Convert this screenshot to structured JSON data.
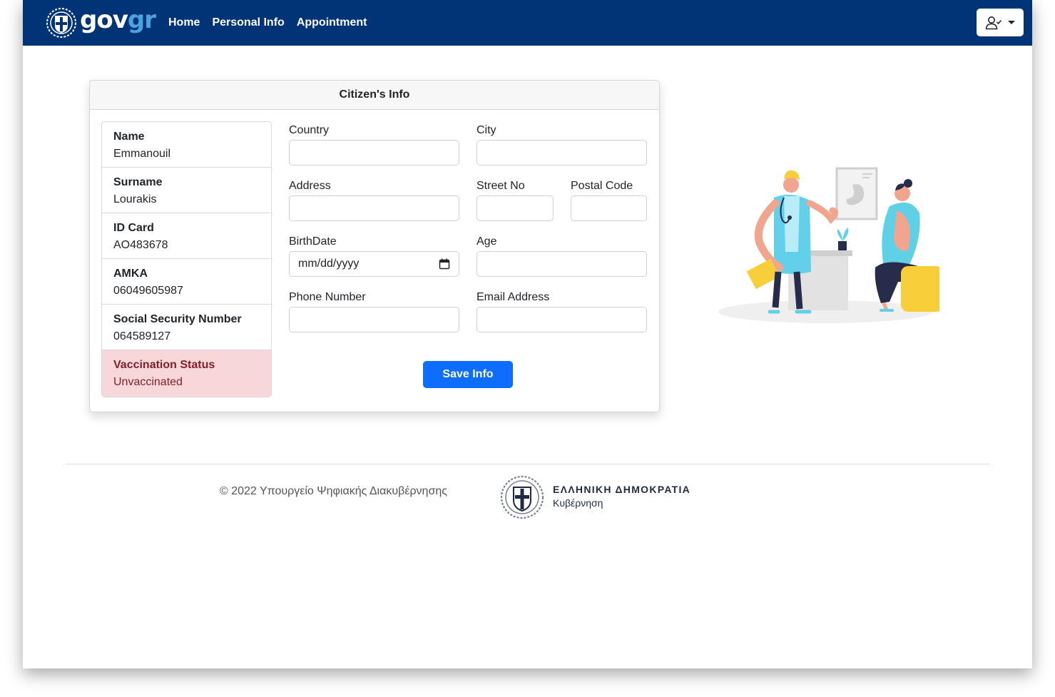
{
  "navbar": {
    "brand_gov": "gov",
    "brand_gr": "gr",
    "links": [
      "Home",
      "Personal Info",
      "Appointment"
    ]
  },
  "card": {
    "title": "Citizen's Info",
    "info": [
      {
        "label": "Name",
        "value": "Emmanouil"
      },
      {
        "label": "Surname",
        "value": "Lourakis"
      },
      {
        "label": "ID Card",
        "value": "AO483678"
      },
      {
        "label": "AMKA",
        "value": "06049605987"
      },
      {
        "label": "Social Security Number",
        "value": "064589127"
      },
      {
        "label": "Vaccination Status",
        "value": "Unvaccinated"
      }
    ],
    "fields": {
      "country": "Country",
      "city": "City",
      "address": "Address",
      "street_no": "Street No",
      "postal_code": "Postal Code",
      "birthdate": "BirthDate",
      "birthdate_placeholder": "mm/dd/yyyy",
      "age": "Age",
      "phone": "Phone Number",
      "email": "Email Address"
    },
    "save_label": "Save Info"
  },
  "footer": {
    "copyright": "© 2022 Υπουργείο Ψηφιακής Διακυβέρνησης",
    "gov_name": "ΕΛΛΗΝΙΚΗ ΔΗΜΟΚΡΑΤΙΑ",
    "gov_sub": "Κυβέρνηση"
  },
  "colors": {
    "navbar": "#003476",
    "primary": "#0d6efd",
    "danger_bg": "#f8d7da",
    "danger_text": "#842029"
  },
  "icons": [
    "greek-emblem-icon",
    "user-check-icon",
    "caret-down-icon",
    "calendar-icon"
  ]
}
